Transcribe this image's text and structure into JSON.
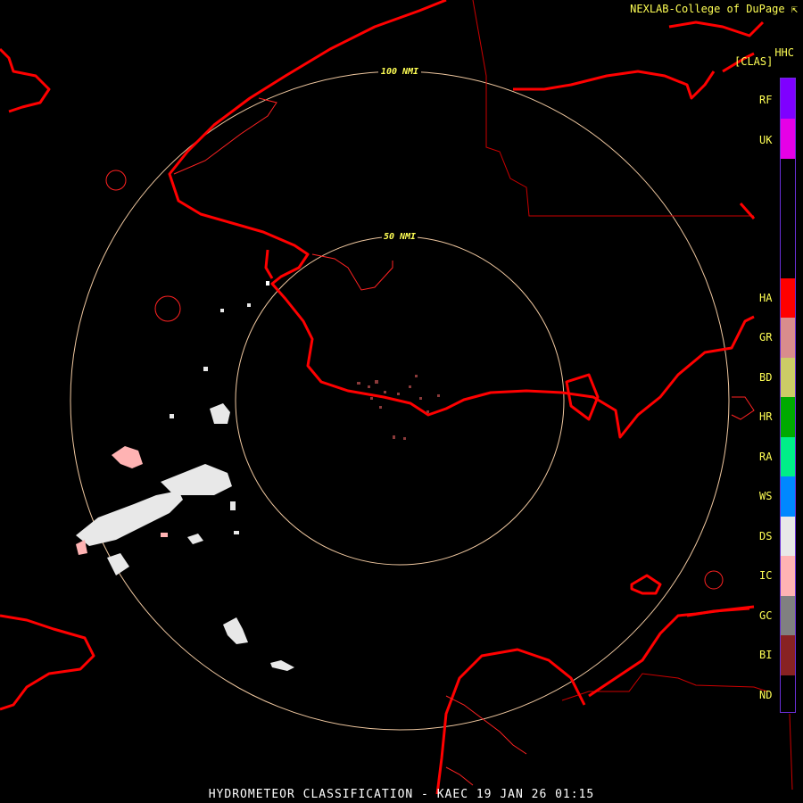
{
  "header": {
    "source": "NEXLAB-College of DuPage"
  },
  "product_code": "HHC",
  "product_mode": "[CLAS]",
  "footer": {
    "title": "HYDROMETEOR CLASSIFICATION - KAEC 19 JAN 26 01:15"
  },
  "range_rings": [
    {
      "label": "100 NMI"
    },
    {
      "label": "50 NMI"
    }
  ],
  "legend": [
    {
      "code": "RF",
      "color": "#7f00ff"
    },
    {
      "code": "UK",
      "color": "#e600e6"
    },
    {
      "code": "HA",
      "color": "#ff0000"
    },
    {
      "code": "GR",
      "color": "#d98c8c"
    },
    {
      "code": "BD",
      "color": "#cccc66"
    },
    {
      "code": "HR",
      "color": "#00aa00"
    },
    {
      "code": "RA",
      "color": "#00ee88"
    },
    {
      "code": "WS",
      "color": "#0088ff"
    },
    {
      "code": "DS",
      "color": "#e8e8e8"
    },
    {
      "code": "IC",
      "color": "#ffb3b3"
    },
    {
      "code": "GC",
      "color": "#808080"
    },
    {
      "code": "BI",
      "color": "#882222"
    },
    {
      "code": "ND",
      "color": "#000000"
    }
  ],
  "colors": {
    "coastline": "#ff0000",
    "ring": "#f0c8a0",
    "text": "#ffff55"
  }
}
